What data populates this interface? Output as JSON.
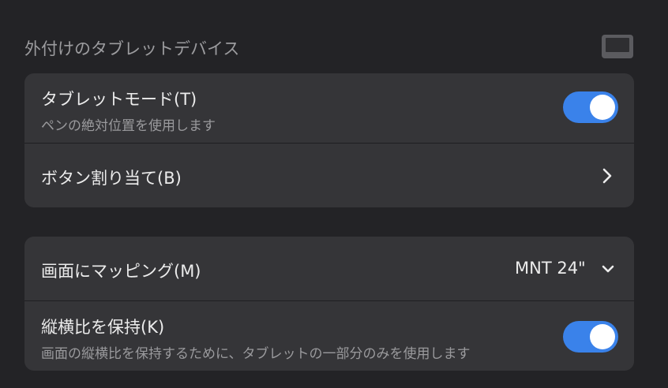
{
  "section": {
    "title": "外付けのタブレットデバイス",
    "icon": "tablet-device-icon"
  },
  "tablet_mode": {
    "label": "タブレットモード(T)",
    "description": "ペンの絶対位置を使用します",
    "enabled": true
  },
  "button_assign": {
    "label": "ボタン割り当て(B)",
    "icon": "chevron-right-icon"
  },
  "map_to_screen": {
    "label": "画面にマッピング(M)",
    "selected": "MNT 24\"",
    "icon": "chevron-down-icon"
  },
  "keep_aspect": {
    "label": "縦横比を保持(K)",
    "description": "画面の縦横比を保持するために、タブレットの一部分のみを使用します",
    "enabled": true
  },
  "colors": {
    "background": "#232326",
    "card": "#353538",
    "accent": "#3a82ea"
  }
}
